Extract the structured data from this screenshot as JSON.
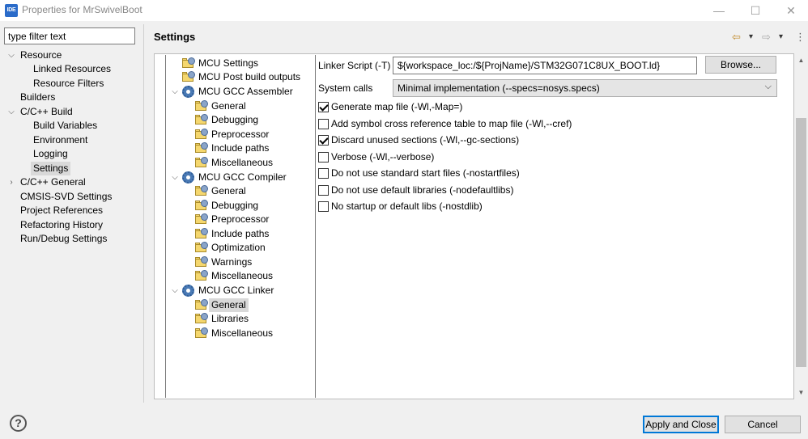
{
  "window": {
    "title": "Properties for MrSwivelBoot",
    "app_icon": "IDE",
    "minimize": "—",
    "maximize": "☐",
    "close": "✕"
  },
  "filter": {
    "placeholder": "type filter text"
  },
  "nav": {
    "items": [
      {
        "label": "Resource"
      },
      {
        "label": "Linked Resources"
      },
      {
        "label": "Resource Filters"
      },
      {
        "label": "Builders"
      },
      {
        "label": "C/C++ Build"
      },
      {
        "label": "Build Variables"
      },
      {
        "label": "Environment"
      },
      {
        "label": "Logging"
      },
      {
        "label": "Settings"
      },
      {
        "label": "C/C++ General"
      },
      {
        "label": "CMSIS-SVD Settings"
      },
      {
        "label": "Project References"
      },
      {
        "label": "Refactoring History"
      },
      {
        "label": "Run/Debug Settings"
      }
    ],
    "selected": "Settings"
  },
  "page": {
    "title": "Settings"
  },
  "tool_tree": {
    "items": [
      {
        "label": "MCU Settings"
      },
      {
        "label": "MCU Post build outputs"
      },
      {
        "label": "MCU GCC Assembler"
      },
      {
        "label": "General"
      },
      {
        "label": "Debugging"
      },
      {
        "label": "Preprocessor"
      },
      {
        "label": "Include paths"
      },
      {
        "label": "Miscellaneous"
      },
      {
        "label": "MCU GCC Compiler"
      },
      {
        "label": "General"
      },
      {
        "label": "Debugging"
      },
      {
        "label": "Preprocessor"
      },
      {
        "label": "Include paths"
      },
      {
        "label": "Optimization"
      },
      {
        "label": "Warnings"
      },
      {
        "label": "Miscellaneous"
      },
      {
        "label": "MCU GCC Linker"
      },
      {
        "label": "General"
      },
      {
        "label": "Libraries"
      },
      {
        "label": "Miscellaneous"
      }
    ],
    "selected": "MCU GCC Linker / General"
  },
  "form": {
    "linker_script_label": "Linker Script (-T)",
    "linker_script_value": "${workspace_loc:/${ProjName}/STM32G071C8UX_BOOT.ld}",
    "browse_label": "Browse...",
    "system_calls_label": "System calls",
    "system_calls_value": "Minimal implementation (--specs=nosys.specs)",
    "options": [
      {
        "label": "Generate map file (-Wl,-Map=)",
        "checked": true
      },
      {
        "label": "Add symbol cross reference table to map file (-Wl,--cref)",
        "checked": false
      },
      {
        "label": "Discard unused sections (-Wl,--gc-sections)",
        "checked": true
      },
      {
        "label": "Verbose (-Wl,--verbose)",
        "checked": false
      },
      {
        "label": "Do not use standard start files (-nostartfiles)",
        "checked": false
      },
      {
        "label": "Do not use default libraries (-nodefaultlibs)",
        "checked": false
      },
      {
        "label": "No startup or default libs (-nostdlib)",
        "checked": false
      }
    ]
  },
  "buttons": {
    "apply_close": "Apply and Close",
    "cancel": "Cancel",
    "help": "?"
  },
  "toolbar": {
    "back": "⇦",
    "back_menu": "▾",
    "forward": "⇨",
    "forward_menu": "▾",
    "menu": "⋮"
  },
  "scrollbar": {
    "up": "▲",
    "down": "▼"
  },
  "colors": {
    "accent": "#0078d7",
    "selection": "#d9d9d9"
  }
}
